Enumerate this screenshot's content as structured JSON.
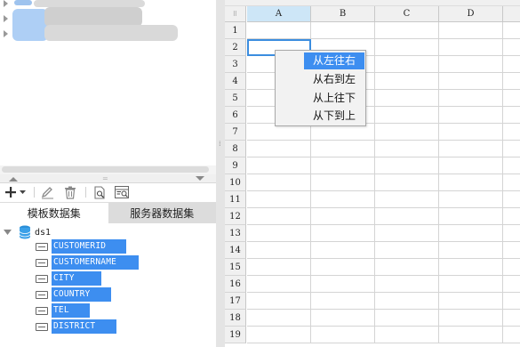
{
  "left_panel": {
    "toolbar": {
      "add": "add-icon",
      "add_dropdown": "chevron-down-icon",
      "edit": "edit-icon",
      "delete": "delete-icon",
      "preview": "preview-icon",
      "replace": "replace-icon"
    },
    "tabs": [
      {
        "label": "模板数据集",
        "active": true
      },
      {
        "label": "服务器数据集",
        "active": false
      }
    ],
    "dataset": {
      "name": "ds1",
      "fields": [
        "CUSTOMERID",
        "CUSTOMERNAME",
        "CITY",
        "COUNTRY",
        "TEL",
        "DISTRICT"
      ]
    }
  },
  "grid": {
    "columns": [
      "A",
      "B",
      "C",
      "D"
    ],
    "rows": [
      "1",
      "2",
      "3",
      "4",
      "5",
      "6",
      "7",
      "8",
      "9",
      "10",
      "11",
      "12",
      "13",
      "14",
      "15",
      "16",
      "17",
      "18",
      "19"
    ],
    "selected_cell": "A2"
  },
  "context_menu": {
    "items": [
      "从左往右",
      "从右到左",
      "从上往下",
      "从下到上"
    ],
    "highlighted": "从左往右"
  },
  "colors": {
    "accent": "#3d8ef0",
    "selected_header": "#cde6f7",
    "inactive_tab": "#dcdcdc"
  }
}
